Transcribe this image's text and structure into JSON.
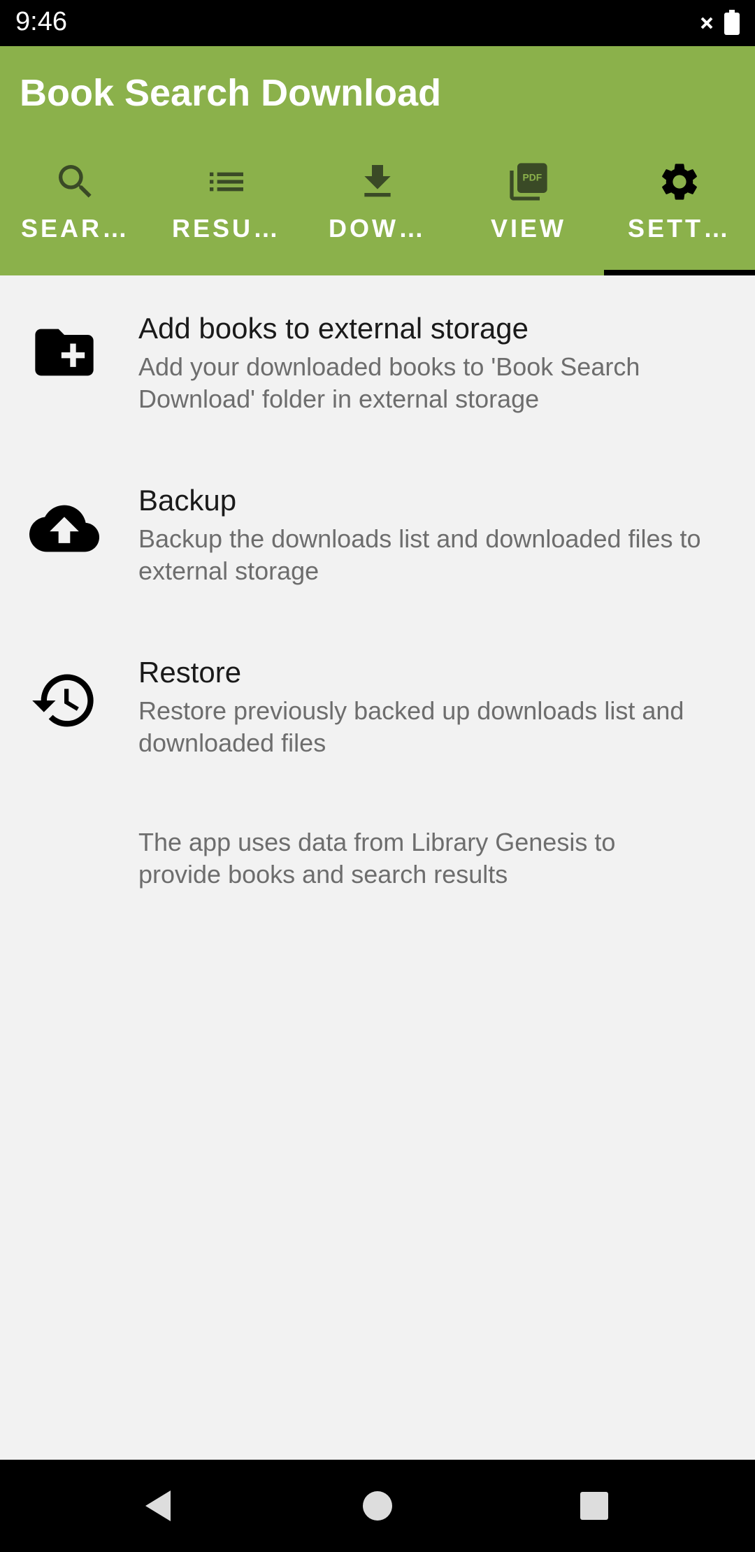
{
  "status": {
    "time": "9:46"
  },
  "app": {
    "title": "Book Search Download",
    "accent_color": "#8bb14b"
  },
  "tabs": [
    {
      "label": "SEAR…",
      "icon": "search-icon",
      "active": false
    },
    {
      "label": "RESU…",
      "icon": "list-icon",
      "active": false
    },
    {
      "label": "DOW…",
      "icon": "download-icon",
      "active": false
    },
    {
      "label": "VIEW",
      "icon": "pdf-icon",
      "active": false
    },
    {
      "label": "SETT…",
      "icon": "gear-icon",
      "active": true
    }
  ],
  "settings": [
    {
      "title": "Add books to external storage",
      "description": "Add your downloaded books to 'Book Search Download' folder in external storage",
      "icon": "folder-add-icon"
    },
    {
      "title": "Backup",
      "description": "Backup the downloads list and downloaded files to external storage",
      "icon": "cloud-upload-icon"
    },
    {
      "title": "Restore",
      "description": "Restore previously backed up downloads list and downloaded files",
      "icon": "history-icon"
    }
  ],
  "footer_note": "The app uses data from Library Genesis to provide books and search results",
  "nav": {
    "back": "back-icon",
    "home": "home-icon",
    "recents": "recents-icon"
  }
}
